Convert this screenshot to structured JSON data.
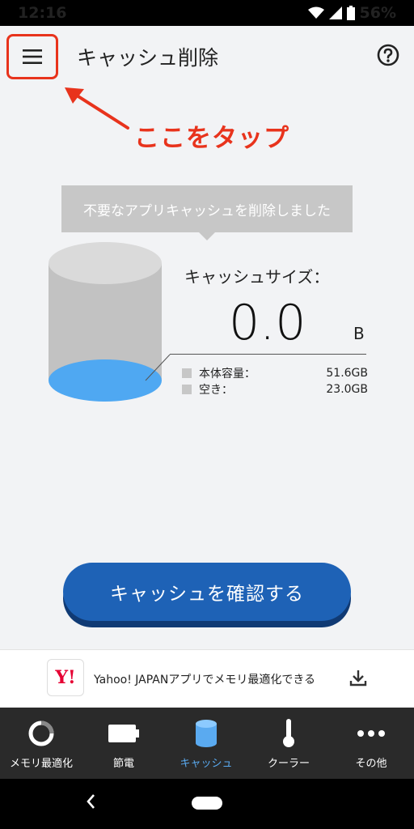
{
  "status": {
    "time": "12:16",
    "battery": "56%"
  },
  "header": {
    "title": "キャッシュ削除",
    "menu_icon": "hamburger-menu-icon",
    "help_icon": "help-circle-icon"
  },
  "annotation": {
    "tap_here": "ここをタップ",
    "color": "#e8331c"
  },
  "toast": {
    "message": "不要なアプリキャッシュを削除しました"
  },
  "cache": {
    "label": "キャッシュサイズ：",
    "value": "0.0",
    "unit": "B",
    "stats": [
      {
        "label": "本体容量：",
        "value": "51.6GB"
      },
      {
        "label": "空き：",
        "value": "23.0GB"
      }
    ]
  },
  "confirm_button": {
    "label": "キャッシュを確認する",
    "color": "#1e62b6"
  },
  "ad": {
    "text": "Yahoo! JAPANアプリでメモリ最適化できる",
    "logo": "Y!"
  },
  "bottom_nav": {
    "items": [
      {
        "label": "メモリ最適化",
        "icon": "memory-ring-icon"
      },
      {
        "label": "節電",
        "icon": "battery-icon"
      },
      {
        "label": "キャッシュ",
        "icon": "cylinder-icon",
        "active": true
      },
      {
        "label": "クーラー",
        "icon": "thermometer-icon"
      },
      {
        "label": "その他",
        "icon": "more-dots-icon"
      }
    ],
    "active_color": "#5aaaf0"
  }
}
